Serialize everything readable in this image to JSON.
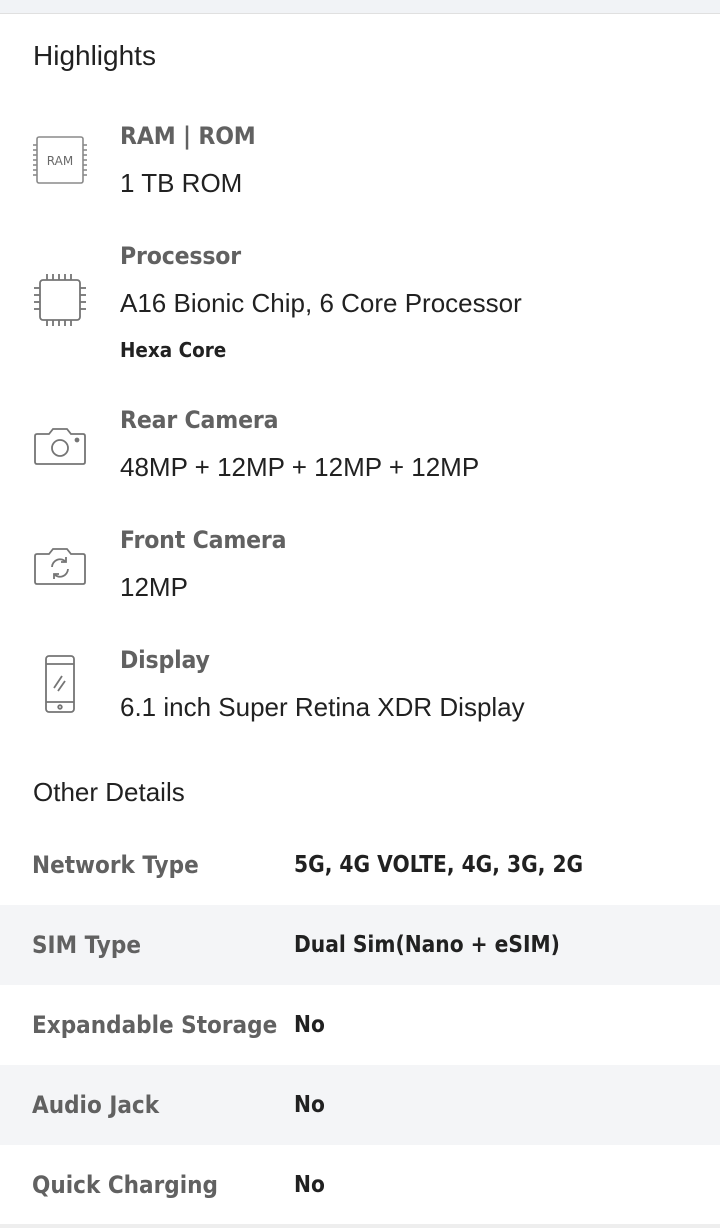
{
  "highlights": {
    "title": "Highlights",
    "items": [
      {
        "icon": "ram-chip-icon",
        "icon_text": "RAM",
        "label": "RAM | ROM",
        "value": "1 TB ROM",
        "sub": ""
      },
      {
        "icon": "processor-chip-icon",
        "label": "Processor",
        "value": "A16 Bionic Chip, 6 Core Processor",
        "sub": "Hexa Core"
      },
      {
        "icon": "rear-camera-icon",
        "label": "Rear Camera",
        "value": "48MP + 12MP + 12MP + 12MP",
        "sub": ""
      },
      {
        "icon": "front-camera-icon",
        "label": "Front Camera",
        "value": "12MP",
        "sub": ""
      },
      {
        "icon": "phone-display-icon",
        "label": "Display",
        "value": "6.1 inch Super Retina XDR Display",
        "sub": ""
      }
    ]
  },
  "other_details": {
    "title": "Other Details",
    "rows": [
      {
        "key": "Network Type",
        "value": "5G, 4G VOLTE, 4G, 3G, 2G"
      },
      {
        "key": "SIM Type",
        "value": "Dual Sim(Nano + eSIM)"
      },
      {
        "key": "Expandable Storage",
        "value": "No"
      },
      {
        "key": "Audio Jack",
        "value": "No"
      },
      {
        "key": "Quick Charging",
        "value": "No"
      }
    ]
  },
  "colors": {
    "label_gray": "#616161",
    "text_dark": "#212121",
    "alt_row_bg": "#f4f5f7",
    "icon_gray": "#757575"
  }
}
